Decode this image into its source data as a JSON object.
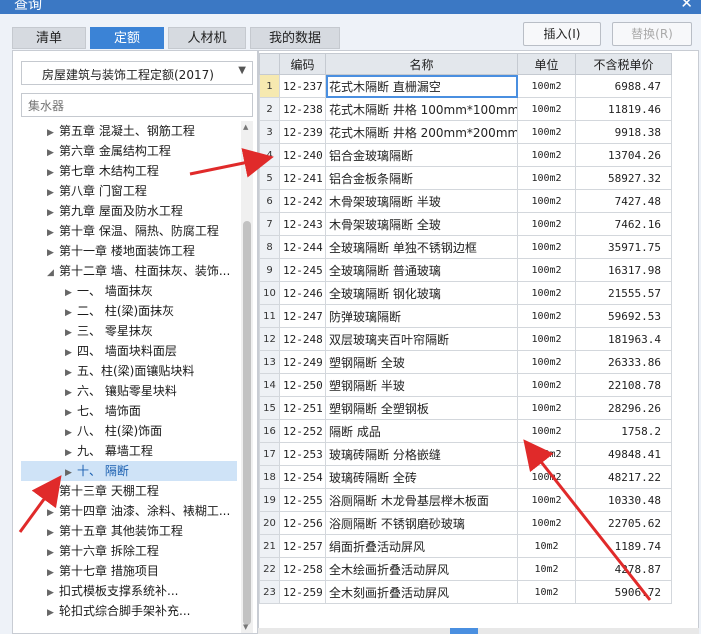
{
  "window": {
    "title": "查询",
    "close_icon": "close-icon"
  },
  "tabs": [
    {
      "label": "清单",
      "active": false
    },
    {
      "label": "定额",
      "active": true
    },
    {
      "label": "人材机",
      "active": false
    },
    {
      "label": "我的数据",
      "active": false
    }
  ],
  "buttons": {
    "insert": "插入(I)",
    "replace": "替换(R)"
  },
  "left": {
    "select_value": "房屋建筑与装饰工程定额(2017)",
    "search_placeholder": "集水器",
    "tree": [
      {
        "label": "第五章 混凝土、钢筋工程",
        "level": 0,
        "expanded": false,
        "selected": false
      },
      {
        "label": "第六章 金属结构工程",
        "level": 0,
        "expanded": false,
        "selected": false
      },
      {
        "label": "第七章 木结构工程",
        "level": 0,
        "expanded": false,
        "selected": false
      },
      {
        "label": "第八章 门窗工程",
        "level": 0,
        "expanded": false,
        "selected": false
      },
      {
        "label": "第九章 屋面及防水工程",
        "level": 0,
        "expanded": false,
        "selected": false
      },
      {
        "label": "第十章 保温、隔热、防腐工程",
        "level": 0,
        "expanded": false,
        "selected": false
      },
      {
        "label": "第十一章 楼地面装饰工程",
        "level": 0,
        "expanded": false,
        "selected": false
      },
      {
        "label": "第十二章 墙、柱面抹灰、装饰...",
        "level": 0,
        "expanded": true,
        "selected": false
      },
      {
        "label": "一、 墙面抹灰",
        "level": 1,
        "expanded": false,
        "selected": false
      },
      {
        "label": "二、 柱(梁)面抹灰",
        "level": 1,
        "expanded": false,
        "selected": false
      },
      {
        "label": "三、 零星抹灰",
        "level": 1,
        "expanded": false,
        "selected": false
      },
      {
        "label": "四、 墙面块料面层",
        "level": 1,
        "expanded": false,
        "selected": false
      },
      {
        "label": "五、柱(梁)面镶贴块料",
        "level": 1,
        "expanded": false,
        "selected": false
      },
      {
        "label": "六、 镶贴零星块料",
        "level": 1,
        "expanded": false,
        "selected": false
      },
      {
        "label": "七、 墙饰面",
        "level": 1,
        "expanded": false,
        "selected": false
      },
      {
        "label": "八、 柱(梁)饰面",
        "level": 1,
        "expanded": false,
        "selected": false
      },
      {
        "label": "九、 幕墙工程",
        "level": 1,
        "expanded": false,
        "selected": false
      },
      {
        "label": "十、 隔断",
        "level": 1,
        "expanded": false,
        "selected": true
      },
      {
        "label": "第十三章 天棚工程",
        "level": 0,
        "expanded": false,
        "selected": false
      },
      {
        "label": "第十四章 油漆、涂料、裱糊工...",
        "level": 0,
        "expanded": false,
        "selected": false
      },
      {
        "label": "第十五章 其他装饰工程",
        "level": 0,
        "expanded": false,
        "selected": false
      },
      {
        "label": "第十六章 拆除工程",
        "level": 0,
        "expanded": false,
        "selected": false
      },
      {
        "label": "第十七章 措施项目",
        "level": 0,
        "expanded": false,
        "selected": false
      },
      {
        "label": "扣式模板支撑系统补...",
        "level": 0,
        "expanded": false,
        "selected": false
      },
      {
        "label": "轮扣式综合脚手架补充...",
        "level": 0,
        "expanded": false,
        "selected": false
      }
    ]
  },
  "grid": {
    "headers": [
      "编码",
      "名称",
      "单位",
      "不含税单价"
    ],
    "rows": [
      {
        "idx": "1",
        "code": "12-237",
        "name": "花式木隔断 直栅漏空",
        "unit": "100m2",
        "price": "6988.47"
      },
      {
        "idx": "2",
        "code": "12-238",
        "name": "花式木隔断 井格 100mm*100mm",
        "unit": "100m2",
        "price": "11819.46"
      },
      {
        "idx": "3",
        "code": "12-239",
        "name": "花式木隔断 井格 200mm*200mm",
        "unit": "100m2",
        "price": "9918.38"
      },
      {
        "idx": "4",
        "code": "12-240",
        "name": "铝合金玻璃隔断",
        "unit": "100m2",
        "price": "13704.26"
      },
      {
        "idx": "5",
        "code": "12-241",
        "name": "铝合金板条隔断",
        "unit": "100m2",
        "price": "58927.32"
      },
      {
        "idx": "6",
        "code": "12-242",
        "name": "木骨架玻璃隔断 半玻",
        "unit": "100m2",
        "price": "7427.48"
      },
      {
        "idx": "7",
        "code": "12-243",
        "name": "木骨架玻璃隔断 全玻",
        "unit": "100m2",
        "price": "7462.16"
      },
      {
        "idx": "8",
        "code": "12-244",
        "name": "全玻璃隔断 单独不锈钢边框",
        "unit": "100m2",
        "price": "35971.75"
      },
      {
        "idx": "9",
        "code": "12-245",
        "name": "全玻璃隔断 普通玻璃",
        "unit": "100m2",
        "price": "16317.98"
      },
      {
        "idx": "10",
        "code": "12-246",
        "name": "全玻璃隔断 钢化玻璃",
        "unit": "100m2",
        "price": "21555.57"
      },
      {
        "idx": "11",
        "code": "12-247",
        "name": "防弹玻璃隔断",
        "unit": "100m2",
        "price": "59692.53"
      },
      {
        "idx": "12",
        "code": "12-248",
        "name": "双层玻璃夹百叶帘隔断",
        "unit": "100m2",
        "price": "181963.4"
      },
      {
        "idx": "13",
        "code": "12-249",
        "name": "塑钢隔断 全玻",
        "unit": "100m2",
        "price": "26333.86"
      },
      {
        "idx": "14",
        "code": "12-250",
        "name": "塑钢隔断 半玻",
        "unit": "100m2",
        "price": "22108.78"
      },
      {
        "idx": "15",
        "code": "12-251",
        "name": "塑钢隔断 全塑钢板",
        "unit": "100m2",
        "price": "28296.26"
      },
      {
        "idx": "16",
        "code": "12-252",
        "name": "隔断 成品",
        "unit": "100m2",
        "price": "1758.2"
      },
      {
        "idx": "17",
        "code": "12-253",
        "name": "玻璃砖隔断 分格嵌缝",
        "unit": "100m2",
        "price": "49848.41"
      },
      {
        "idx": "18",
        "code": "12-254",
        "name": "玻璃砖隔断 全砖",
        "unit": "100m2",
        "price": "48217.22"
      },
      {
        "idx": "19",
        "code": "12-255",
        "name": "浴厕隔断 木龙骨基层榉木板面",
        "unit": "100m2",
        "price": "10330.48"
      },
      {
        "idx": "20",
        "code": "12-256",
        "name": "浴厕隔断 不锈钢磨砂玻璃",
        "unit": "100m2",
        "price": "22705.62"
      },
      {
        "idx": "21",
        "code": "12-257",
        "name": "绢面折叠活动屏风",
        "unit": "10m2",
        "price": "1189.74"
      },
      {
        "idx": "22",
        "code": "12-258",
        "name": "全木绘画折叠活动屏风",
        "unit": "10m2",
        "price": "4278.87"
      },
      {
        "idx": "23",
        "code": "12-259",
        "name": "全木刻画折叠活动屏风",
        "unit": "10m2",
        "price": "5906.72"
      }
    ]
  },
  "colors": {
    "accent": "#3b83d6",
    "annotation": "#e02a2a",
    "selection": "#cfe3f7"
  }
}
